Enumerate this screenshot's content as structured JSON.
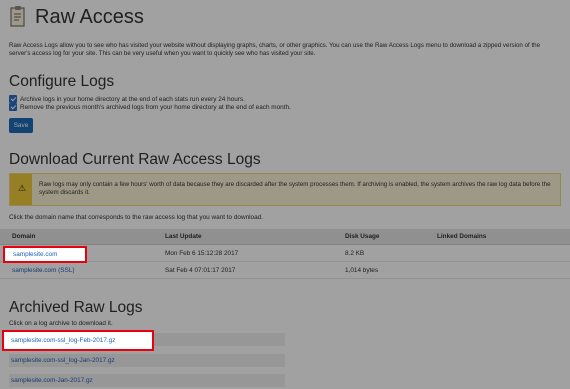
{
  "header": {
    "title": "Raw Access",
    "icon": "document-icon"
  },
  "intro": "Raw Access Logs allow you to see who has visited your website without displaying graphs, charts, or other graphics. You can use the Raw Access Logs menu to download a zipped version of the server's access log for your site. This can be very useful when you want to quickly see who has visited your site.",
  "configure": {
    "heading": "Configure Logs",
    "options": [
      "Archive logs in your home directory at the end of each stats run every 24 hours.",
      "Remove the previous month's archived logs from your home directory at the end of each month."
    ],
    "save_label": "Save"
  },
  "download": {
    "heading": "Download Current Raw Access Logs",
    "warning": "Raw logs may only contain a few hours' worth of data because they are discarded after the system processes them. If archiving is enabled, the system archives the raw log data before the system discards it.",
    "instruction": "Click the domain name that corresponds to the raw access log that you want to download.",
    "columns": [
      "Domain",
      "Last Update",
      "Disk Usage",
      "Linked Domains"
    ],
    "rows": [
      {
        "domain": "samplesite.com",
        "last_update": "Mon Feb 6 15:12:28 2017",
        "disk_usage": "8.2 KB",
        "linked": ""
      },
      {
        "domain": "samplesite.com (SSL)",
        "last_update": "Sat Feb 4 07:01:17 2017",
        "disk_usage": "1,014 bytes",
        "linked": ""
      }
    ]
  },
  "archived": {
    "heading": "Archived Raw Logs",
    "instruction": "Click on a log archive to download it.",
    "items": [
      "samplesite.com-ssl_log-Feb-2017.gz",
      "samplesite.com-ssl_log-Jan-2017.gz",
      "samplesite.com-Jan-2017.gz"
    ]
  },
  "colors": {
    "link": "#2160b5",
    "highlight_border": "#e8000f",
    "button": "#1f6bb7",
    "warning_bar": "#f0c93b"
  }
}
